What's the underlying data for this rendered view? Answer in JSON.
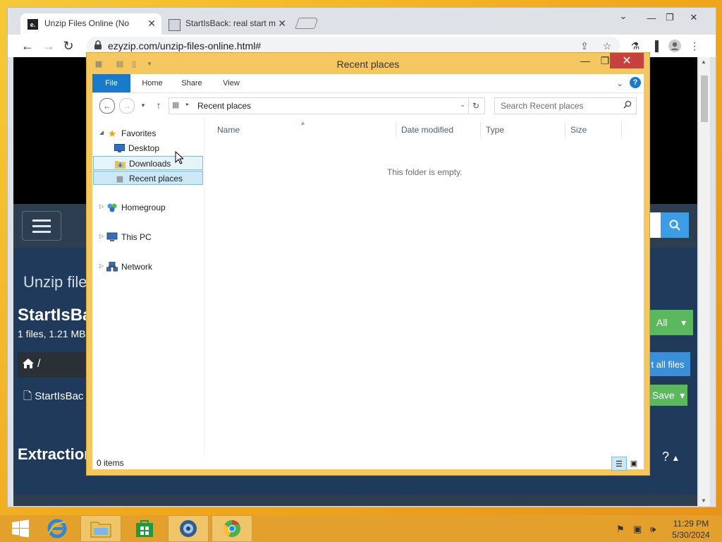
{
  "browser": {
    "tabs": [
      {
        "title": "Unzip Files Online (No",
        "favicon": "e."
      },
      {
        "title": "StartIsBack: real start m",
        "favicon": ""
      }
    ],
    "url": "ezyzip.com/unzip-files-online.html#"
  },
  "webpage": {
    "heading": "Unzip files",
    "file_title": "StartIsBa",
    "file_meta": "1 files, 1.21 MB",
    "path_slash": "/",
    "file_name": "StartIsBac",
    "all_button": "All",
    "extract_all_button": "t all files",
    "save_button": "Save",
    "extraction_heading": "Extraction",
    "help_text": "?"
  },
  "explorer": {
    "title": "Recent places",
    "ribbon_tabs": [
      "File",
      "Home",
      "Share",
      "View"
    ],
    "address_text": "Recent places",
    "search_placeholder": "Search Recent places",
    "nav": {
      "favorites": "Favorites",
      "desktop": "Desktop",
      "downloads": "Downloads",
      "recent": "Recent places",
      "homegroup": "Homegroup",
      "thispc": "This PC",
      "network": "Network"
    },
    "columns": [
      "Name",
      "Date modified",
      "Type",
      "Size"
    ],
    "empty_message": "This folder is empty.",
    "status": "0 items"
  },
  "taskbar": {
    "time": "11:29 PM",
    "date": "5/30/2024"
  },
  "colors": {
    "file_tab": "#1979ca",
    "window_frame": "#f5c760",
    "taskbar": "#e3a02c",
    "close_button": "#c84040"
  }
}
